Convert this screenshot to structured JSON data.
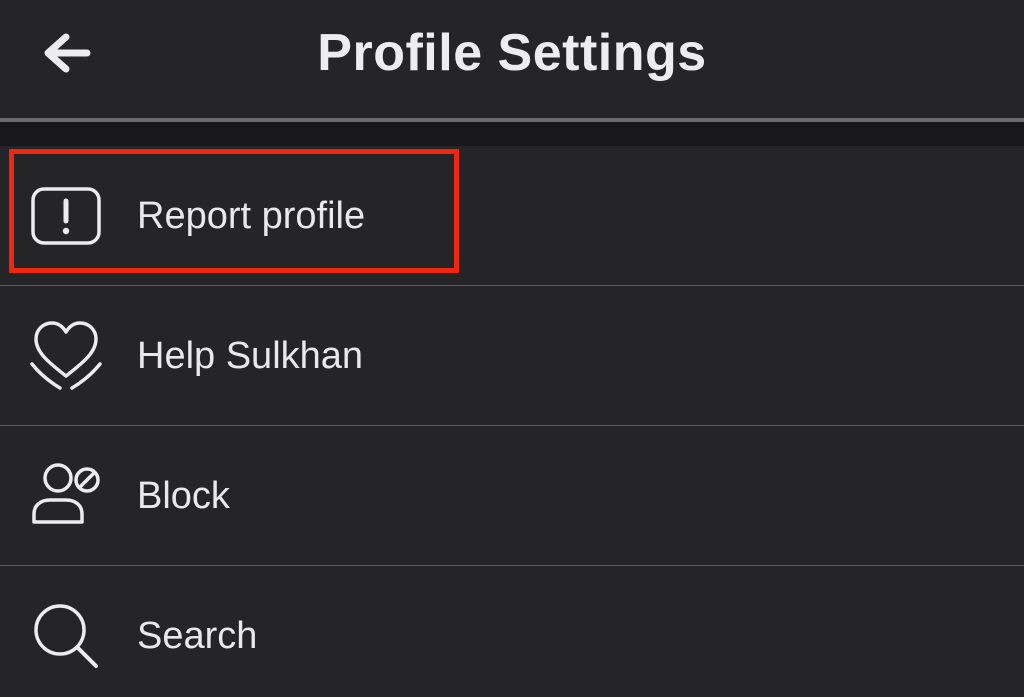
{
  "header": {
    "title": "Profile Settings",
    "back_icon": "arrow-left-icon"
  },
  "menu": {
    "items": [
      {
        "label": "Report profile",
        "icon": "alert-box-icon"
      },
      {
        "label": "Help Sulkhan",
        "icon": "heart-hands-icon"
      },
      {
        "label": "Block",
        "icon": "block-user-icon"
      },
      {
        "label": "Search",
        "icon": "search-icon"
      }
    ]
  },
  "annotation": {
    "highlight_color": "#f1260f",
    "highlighted_item": "Report profile"
  },
  "colors": {
    "background": "#252527",
    "text": "#e9e9eb",
    "divider": "#5c5c60"
  }
}
